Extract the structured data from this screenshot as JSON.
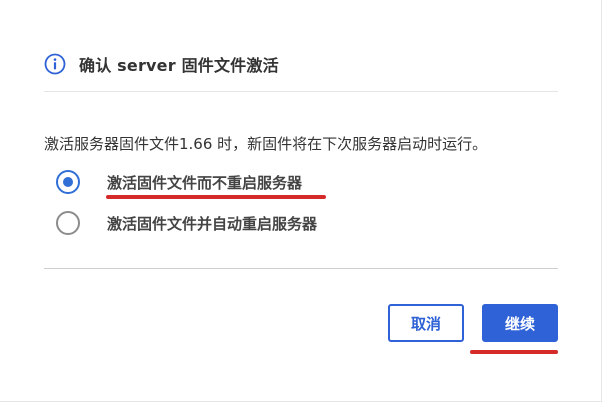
{
  "dialog": {
    "title": "确认 server 固件文件激活",
    "title_icon": "info-icon",
    "description": "激活服务器固件文件1.66 时，新固件将在下次服务器启动时运行。",
    "options": [
      {
        "label": "激活固件文件而不重启服务器",
        "checked": true
      },
      {
        "label": "激活固件文件并自动重启服务器",
        "checked": false
      }
    ],
    "buttons": {
      "cancel_label": "取消",
      "continue_label": "继续"
    }
  },
  "colors": {
    "accent": "#2f62d6",
    "highlight": "#d42a2a"
  }
}
